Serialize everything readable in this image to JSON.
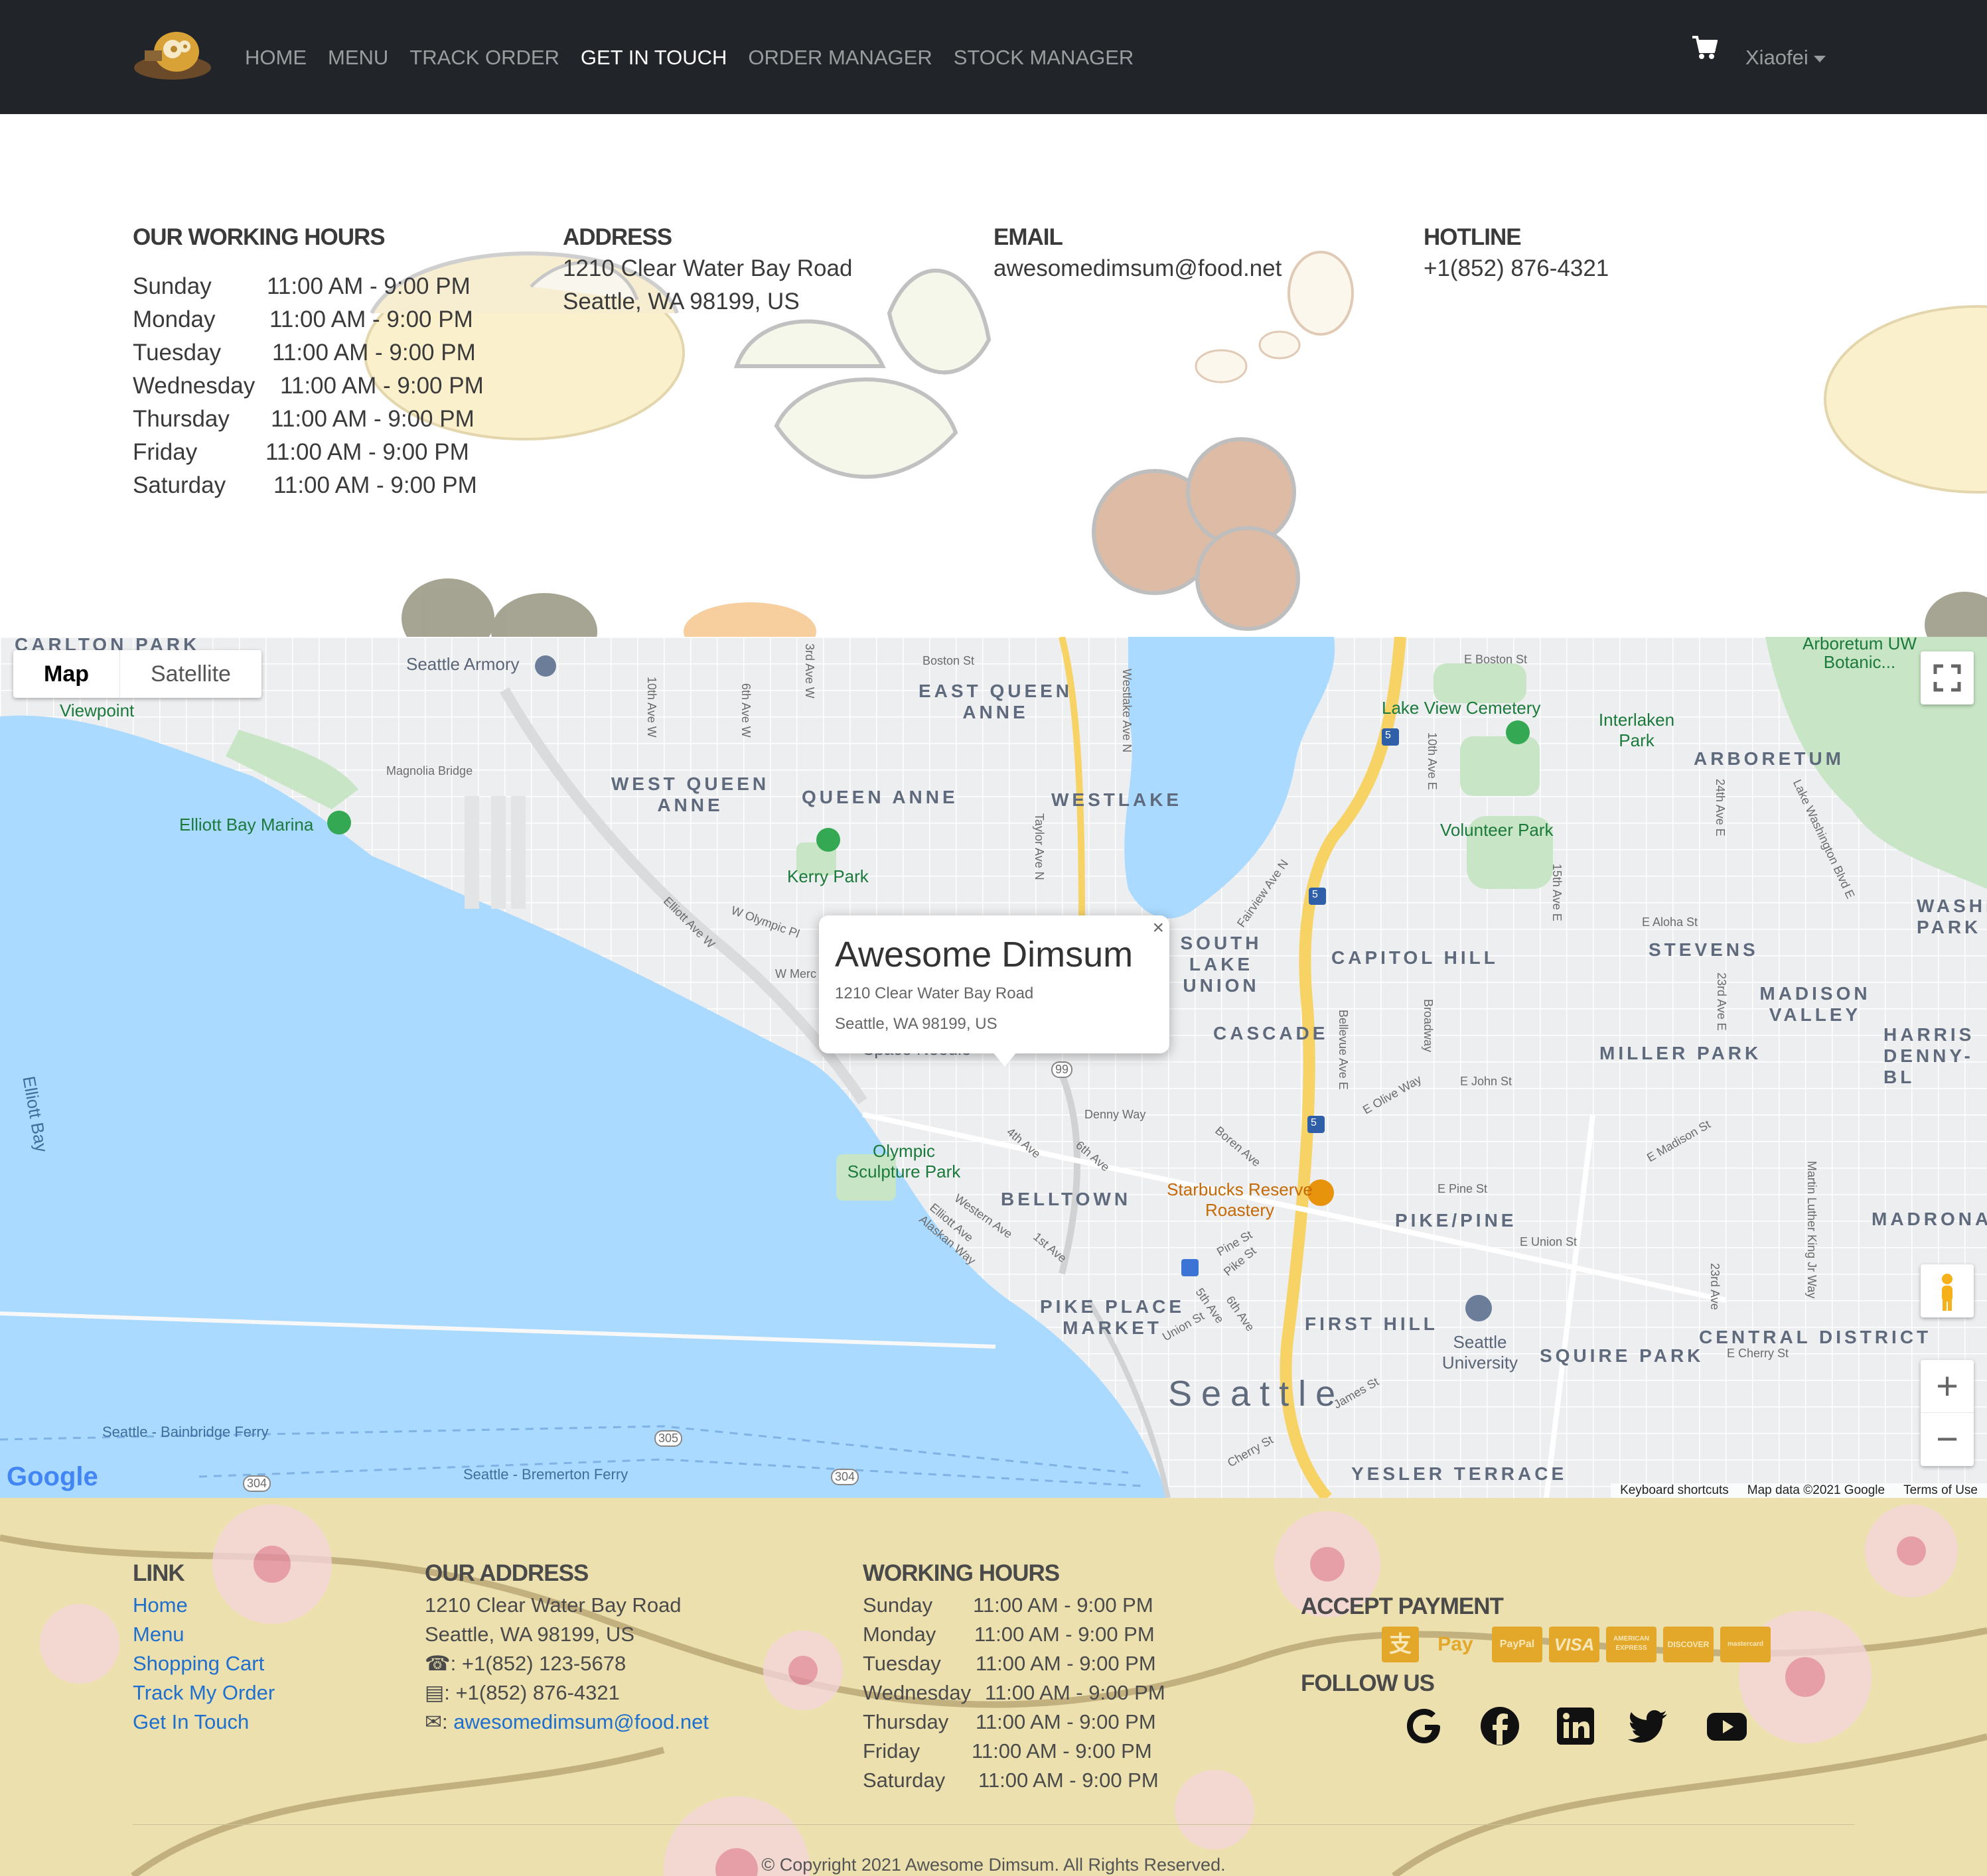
{
  "nav": {
    "links": [
      "HOME",
      "MENU",
      "TRACK ORDER",
      "GET IN TOUCH",
      "ORDER MANAGER",
      "STOCK MANAGER"
    ],
    "active_index": 3,
    "cart_icon": "shopping-cart-icon",
    "user": "Xiaofei"
  },
  "contact": {
    "hours_title": "OUR WORKING HOURS",
    "hours": [
      {
        "day": "Sunday",
        "time": "11:00 AM - 9:00 PM"
      },
      {
        "day": "Monday",
        "time": "11:00 AM - 9:00 PM"
      },
      {
        "day": "Tuesday",
        "time": "11:00 AM - 9:00 PM"
      },
      {
        "day": "Wednesday",
        "time": "11:00 AM - 9:00 PM"
      },
      {
        "day": "Thursday",
        "time": "11:00 AM - 9:00 PM"
      },
      {
        "day": "Friday",
        "time": "11:00 AM - 9:00 PM"
      },
      {
        "day": "Saturday",
        "time": "11:00 AM - 9:00 PM"
      }
    ],
    "address_title": "ADDRESS",
    "address_line1": "1210 Clear Water Bay Road",
    "address_line2": "Seattle, WA 98199, US",
    "email_title": "EMAIL",
    "email": "awesomedimsum@food.net",
    "hotline_title": "HOTLINE",
    "hotline": "+1(852) 876-4321"
  },
  "map": {
    "type_buttons": [
      "Map",
      "Satellite"
    ],
    "popup": {
      "title": "Awesome Dimsum",
      "line1": "1210 Clear Water Bay Road",
      "line2": "Seattle, WA 98199, US",
      "close": "×"
    },
    "zoom_in": "+",
    "zoom_out": "−",
    "google": "Google",
    "attribution": [
      "Keyboard shortcuts",
      "Map data ©2021 Google",
      "Terms of Use"
    ],
    "districts": [
      "CARLTON PARK",
      "EAST QUEEN ANNE",
      "WEST QUEEN ANNE",
      "QUEEN ANNE",
      "WESTLAKE",
      "ARBORETUM",
      "SOUTH LAKE UNION",
      "CAPITOL HILL",
      "STEVENS",
      "MADISON VALLEY",
      "WASHINGTON PARK",
      "CASCADE",
      "MILLER PARK",
      "HARRIS DENNY-BL",
      "BELLTOWN",
      "PIKE/PINE",
      "MADRONA",
      "PIKE PLACE MARKET",
      "FIRST HILL",
      "SQUIRE PARK",
      "CENTRAL DISTRICT",
      "Seattle",
      "YESLER TERRACE"
    ],
    "places": [
      "Seattle Armory",
      "Viewpoint",
      "Magnolia Bridge",
      "Elliott Bay Marina",
      "Kerry Park",
      "Lake View Cemetery",
      "Interlaken Park",
      "Volunteer Park",
      "Olympic Sculpture Park",
      "Starbucks Reserve Roastery",
      "Seattle University",
      "Seattle - Bainbridge Ferry",
      "Seattle - Bremerton Ferry",
      "Elliott Bay",
      "Space Needle",
      "Arboretum UW Botanic..."
    ],
    "streets": [
      "Boston St",
      "E Boston St",
      "10th Ave W",
      "6th Ave W",
      "3rd Ave W",
      "Westlake Ave N",
      "Taylor Ave N",
      "Elliott Ave W",
      "W Olympic Pl",
      "W Merc",
      "Fairview Ave N",
      "10th Ave E",
      "24th Ave E",
      "15th Ave E",
      "E Aloha St",
      "23rd Ave E",
      "Bellevue Ave E",
      "Broadway",
      "E Olive Way",
      "E John St",
      "Denny Way",
      "Boren Ave",
      "4th Ave",
      "6th Ave",
      "Western Ave",
      "Elliott Ave",
      "Alaskan Way",
      "1st Ave",
      "E Madison St",
      "E Pine St",
      "Pine St",
      "Pike St",
      "5th Ave",
      "6th Ave",
      "Union St",
      "E Union St",
      "Martin Luther King Jr Way",
      "23rd Ave",
      "E Cherry St",
      "James St",
      "Cherry St",
      "Lake Washington Blvd E"
    ],
    "shields": [
      "5",
      "5",
      "5",
      "99",
      "305",
      "304",
      "304"
    ]
  },
  "footer": {
    "link_title": "LINK",
    "links": [
      "Home",
      "Menu",
      "Shopping Cart",
      "Track My Order",
      "Get In Touch"
    ],
    "address_title": "OUR ADDRESS",
    "address_line1": "1210 Clear Water Bay Road",
    "address_line2": "Seattle, WA 98199, US",
    "phone": ": +1(852) 123-5678",
    "fax": ": +1(852) 876-4321",
    "email_prefix": ": ",
    "email": "awesomedimsum@food.net",
    "hours_title": "WORKING HOURS",
    "hours": [
      {
        "day": "Sunday",
        "time": "11:00 AM - 9:00 PM"
      },
      {
        "day": "Monday",
        "time": "11:00 AM - 9:00 PM"
      },
      {
        "day": "Tuesday",
        "time": "11:00 AM - 9:00 PM"
      },
      {
        "day": "Wednesday",
        "time": "11:00 AM - 9:00 PM"
      },
      {
        "day": "Thursday",
        "time": "11:00 AM - 9:00 PM"
      },
      {
        "day": "Friday",
        "time": "11:00 AM - 9:00 PM"
      },
      {
        "day": "Saturday",
        "time": "11:00 AM - 9:00 PM"
      }
    ],
    "payment_title": "ACCEPT PAYMENT",
    "payments": [
      "支",
      " Pay",
      "PayPal",
      "VISA",
      "AMERICAN EXPRESS",
      "DISCOVER",
      "mastercard"
    ],
    "follow_title": "FOLLOW US",
    "social_icons": [
      "google-icon",
      "facebook-icon",
      "linkedin-icon",
      "twitter-icon",
      "youtube-icon"
    ],
    "copyright": "© Copyright 2021 Awesome Dimsum. All Rights Reserved."
  },
  "colors": {
    "navbar": "#212529",
    "link": "#1f6fcf",
    "footer_bg": "#ebe0ae",
    "payment": "#e3a72a",
    "water": "#aadaff"
  }
}
